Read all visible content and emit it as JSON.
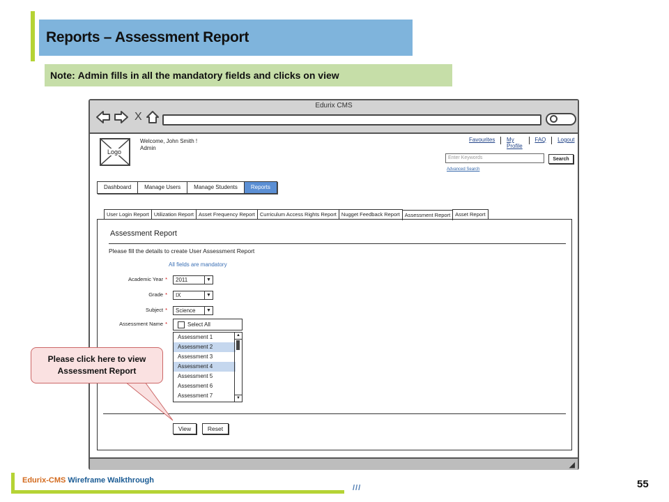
{
  "slide": {
    "title": "Reports – Assessment Report",
    "note_label": "Note:",
    "note_text": "Admin fills in all the mandatory fields and clicks on view",
    "footer_brand": "Edurix-CMS",
    "footer_text": " Wireframe Walkthrough",
    "footer_slashes": "///",
    "page_number": "55",
    "colors": {
      "title_bg": "#7fb4dc",
      "note_bg": "#c6dea8",
      "accent": "#b5d335",
      "active_tab": "#5b8fd4"
    }
  },
  "browser": {
    "window_title": "Edurix CMS",
    "nav_icons": [
      "back-arrow-icon",
      "forward-arrow-icon",
      "close-x-icon",
      "home-icon",
      "search-icon"
    ],
    "close_glyph": "X"
  },
  "header": {
    "logo_label": "Logo",
    "welcome": "Welcome, John Smith !",
    "role": "Admin",
    "links": [
      "Favourites",
      "My Profile",
      "FAQ",
      "Logout"
    ],
    "search_placeholder": "Enter Keywords",
    "search_button": "Search",
    "advanced_search": "Advanced Search"
  },
  "main_nav": {
    "items": [
      "Dashboard",
      "Manage Users",
      "Manage Students",
      "Reports"
    ],
    "active": "Reports"
  },
  "report_tabs": {
    "items": [
      "User Login Report",
      "Utilization Report",
      "Asset Frequency Report",
      "Curriculum Access Rights Report",
      "Nugget Feedback Report",
      "Assessment Report",
      "Asset Report"
    ],
    "active": "Assessment Report"
  },
  "form": {
    "title": "Assessment Report",
    "instruction": "Please fill the details to create User Assessment Report",
    "mandatory_note": "All fields are mandatory",
    "required_mark": "*",
    "academic_year_label": "Academic Year",
    "academic_year_value": "2011",
    "grade_label": "Grade",
    "grade_value": "IX",
    "subject_label": "Subject",
    "subject_value": "Science",
    "assessment_label": "Assessment Name",
    "select_all_label": "Select All",
    "assessments": [
      "Assessment 1",
      "Assessment 2",
      "Assessment 3",
      "Assessment 4",
      "Assessment 5",
      "Assessment 6",
      "Assessment 7"
    ],
    "selected": [
      "Assessment 2",
      "Assessment 4"
    ],
    "view_button": "View",
    "reset_button": "Reset"
  },
  "callout": {
    "line1": "Please click here to view",
    "line2": "Assessment Report"
  }
}
